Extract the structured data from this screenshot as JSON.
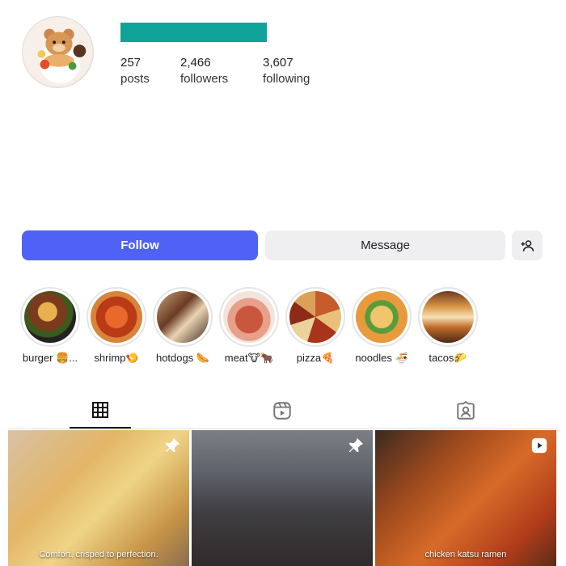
{
  "profile": {
    "username_redacted": true,
    "username_color": "#10a39a",
    "avatar_icon": "bear-cafe-food-avatar"
  },
  "stats": {
    "posts": {
      "value": "257",
      "label": "posts"
    },
    "followers": {
      "value": "2,466",
      "label": "followers"
    },
    "following": {
      "value": "3,607",
      "label": "following"
    }
  },
  "actions": {
    "follow_label": "Follow",
    "message_label": "Message",
    "suggest_icon": "add-person-icon",
    "follow_color": "#4f62f5"
  },
  "highlights": [
    {
      "label": "burger 🍔..."
    },
    {
      "label": "shrimp🍤"
    },
    {
      "label": "hotdogs 🌭"
    },
    {
      "label": "meat🐮🐂"
    },
    {
      "label": "pizza🍕"
    },
    {
      "label": "noodles 🍜"
    },
    {
      "label": "tacos🌮"
    }
  ],
  "tabs": [
    {
      "name": "posts",
      "icon": "grid-icon",
      "active": true
    },
    {
      "name": "reels",
      "icon": "reels-icon",
      "active": false
    },
    {
      "name": "tagged",
      "icon": "tagged-icon",
      "active": false
    }
  ],
  "posts": [
    {
      "caption": "Comfort, crisped to perfection.",
      "badge": "pin-icon"
    },
    {
      "caption": "",
      "badge": "pin-icon"
    },
    {
      "caption": "chicken katsu ramen",
      "badge": "reel-icon"
    }
  ]
}
